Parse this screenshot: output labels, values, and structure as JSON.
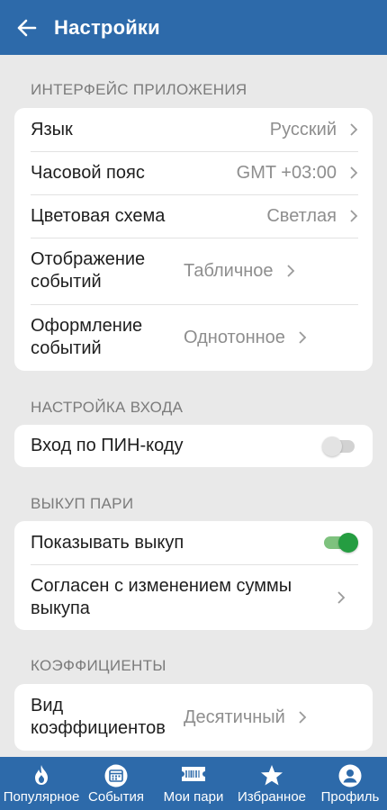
{
  "header": {
    "title": "Настройки"
  },
  "sections": {
    "interface": {
      "title": "ИНТЕРФЕЙС ПРИЛОЖЕНИЯ",
      "rows": [
        {
          "label": "Язык",
          "value": "Русский"
        },
        {
          "label": "Часовой пояс",
          "value": "GMT +03:00"
        },
        {
          "label": "Цветовая схема",
          "value": "Светлая"
        },
        {
          "label": "Отображение событий",
          "value": "Табличное"
        },
        {
          "label": "Оформление событий",
          "value": "Однотонное"
        }
      ]
    },
    "login": {
      "title": "НАСТРОЙКА ВХОДА",
      "rows": [
        {
          "label": "Вход по ПИН-коду",
          "toggle": false
        }
      ]
    },
    "cashout": {
      "title": "ВЫКУП ПАРИ",
      "rows": [
        {
          "label": "Показывать выкуп",
          "toggle": true
        },
        {
          "label": "Согласен с изменением суммы выкупа"
        }
      ]
    },
    "odds": {
      "title": "КОЭФФИЦИЕНТЫ",
      "rows": [
        {
          "label": "Вид коэффициентов",
          "value": "Десятичный"
        }
      ]
    }
  },
  "bottom_nav": [
    {
      "label": "Популярное",
      "icon": "flame-icon"
    },
    {
      "label": "События",
      "icon": "calendar-icon"
    },
    {
      "label": "Мои пари",
      "icon": "ticket-icon"
    },
    {
      "label": "Избранное",
      "icon": "star-icon"
    },
    {
      "label": "Профиль",
      "icon": "user-icon"
    }
  ],
  "colors": {
    "primary": "#2d6aaa",
    "background": "#e9e9e9",
    "toggle_on": "#259d41"
  }
}
